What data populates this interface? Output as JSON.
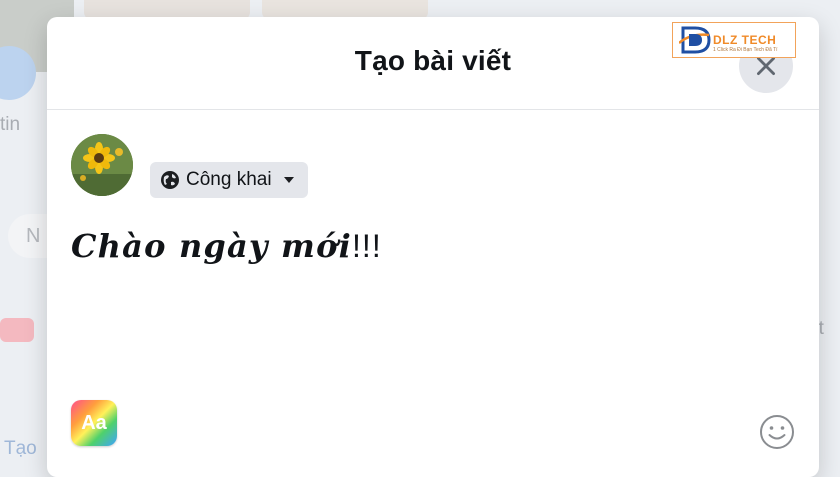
{
  "background": {
    "story_label": "tin",
    "input_placeholder": "N",
    "create_label": "Tạo",
    "right_label": "ạt"
  },
  "modal": {
    "title": "Tạo bài viết",
    "privacy_label": "Công khai",
    "post_text_main": "Chào ngày mới",
    "post_text_tail": "!!!",
    "text_style_button": "Aa"
  },
  "watermark": {
    "brand": "DLZ TECH",
    "tagline": "1 Click Ra Đi Bạn Tech Đã Tí"
  },
  "icons": {
    "close": "close-icon",
    "privacy": "globe-icon",
    "dropdown": "caret-down-icon",
    "emoji": "smiley-icon"
  },
  "colors": {
    "modal_bg": "#ffffff",
    "button_gray": "#e4e6eb",
    "text": "#111418",
    "logo_orange": "#f08a28",
    "logo_blue": "#1f4fa3"
  }
}
